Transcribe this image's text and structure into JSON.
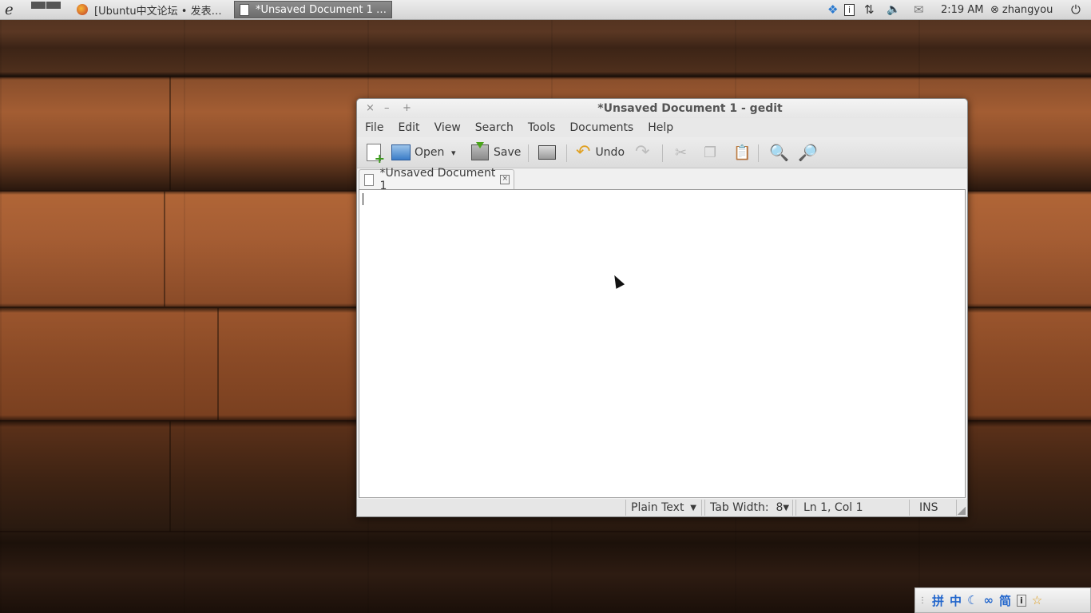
{
  "top_panel": {
    "tasks": [
      {
        "label": "[Ubuntu中文论坛 • 发表…",
        "icon": "firefox-icon"
      },
      {
        "label": "*Unsaved Document 1 …",
        "icon": "text-editor-icon",
        "active": true
      }
    ],
    "clock": "2:19 AM",
    "user": "zhangyou",
    "tray_icons": [
      "dropbox-icon",
      "info-icon",
      "network-icon",
      "volume-icon",
      "mail-icon",
      "user-status-icon",
      "power-icon"
    ]
  },
  "window": {
    "title": "*Unsaved Document 1 - gedit",
    "controls": {
      "close": "×",
      "minimize": "–",
      "maximize": "+"
    },
    "menus": [
      "File",
      "Edit",
      "View",
      "Search",
      "Tools",
      "Documents",
      "Help"
    ],
    "toolbar": {
      "open_label": "Open",
      "save_label": "Save",
      "undo_label": "Undo",
      "dropdown_glyph": "▾"
    },
    "tab": {
      "label": "*Unsaved Document 1"
    },
    "editor": {
      "content": ""
    },
    "status": {
      "language": "Plain Text",
      "tab_width": "Tab Width:  8",
      "position": "Ln 1, Col 1",
      "mode": "INS"
    }
  },
  "ime_tray": {
    "glyphs": [
      "拼",
      "中",
      "☾",
      "∞",
      "简",
      "i",
      "☆"
    ]
  },
  "colors": {
    "accent_blue": "#2266cc",
    "panel_bg": "#e0e0e0"
  }
}
